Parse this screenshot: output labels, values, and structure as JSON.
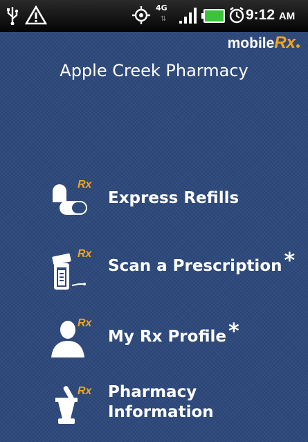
{
  "status_bar": {
    "network": "4G",
    "time": "9:12",
    "ampm": "AM",
    "icons": [
      "usb-icon",
      "warning-icon",
      "gps-icon",
      "4g-icon",
      "signal-icon",
      "battery-icon",
      "alarm-icon"
    ]
  },
  "brand": {
    "mobile": "mobile",
    "rx": "Rx"
  },
  "title": "Apple Creek Pharmacy",
  "menu": [
    {
      "label": "Express Refills",
      "rx": "Rx",
      "asterisk": ""
    },
    {
      "label": "Scan a Prescription",
      "rx": "Rx",
      "asterisk": "*"
    },
    {
      "label": "My Rx Profile",
      "rx": "Rx",
      "asterisk": "*"
    },
    {
      "label_line1": "Pharmacy",
      "label_line2": "Information",
      "rx": "Rx"
    }
  ],
  "colors": {
    "background": "#2e4a7c",
    "accent": "#f2a51c",
    "text": "#ffffff"
  }
}
